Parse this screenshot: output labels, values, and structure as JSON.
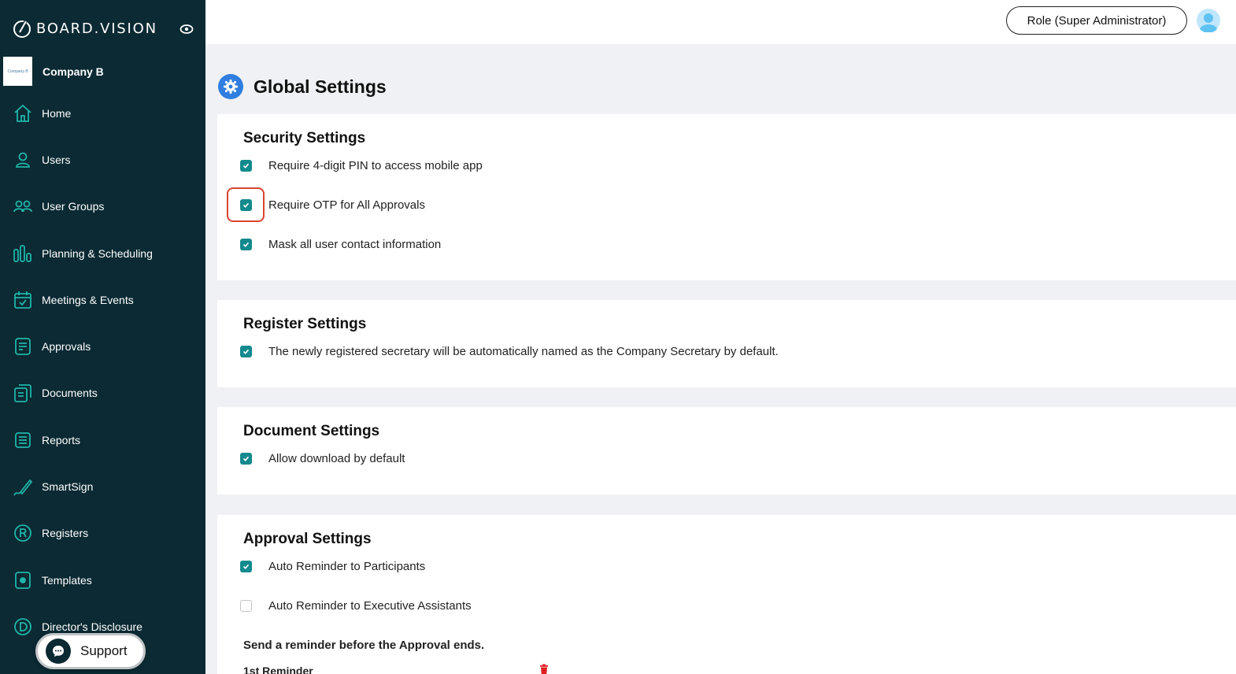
{
  "brand": {
    "name": "BOARD.VISION",
    "logo_icon": "board-vision-logo-icon"
  },
  "company": {
    "name": "Company B",
    "logo_text": "Company B"
  },
  "sidebar": {
    "items": [
      {
        "label": "Home",
        "icon": "home-icon"
      },
      {
        "label": "Users",
        "icon": "user-icon"
      },
      {
        "label": "User Groups",
        "icon": "user-group-icon"
      },
      {
        "label": "Planning & Scheduling",
        "icon": "bar-chart-icon"
      },
      {
        "label": "Meetings & Events",
        "icon": "calendar-check-icon"
      },
      {
        "label": "Approvals",
        "icon": "approval-doc-icon"
      },
      {
        "label": "Documents",
        "icon": "documents-icon"
      },
      {
        "label": "Reports",
        "icon": "report-list-icon"
      },
      {
        "label": "SmartSign",
        "icon": "pen-sign-icon"
      },
      {
        "label": "Registers",
        "icon": "registered-r-icon"
      },
      {
        "label": "Templates",
        "icon": "template-icon"
      },
      {
        "label": "Director's Disclosure",
        "icon": "disclosure-d-icon"
      }
    ]
  },
  "support": {
    "label": "Support"
  },
  "topbar": {
    "role_label": "Role (Super Administrator)"
  },
  "page": {
    "title": "Global Settings"
  },
  "security": {
    "title": "Security Settings",
    "options": [
      {
        "label": "Require 4-digit PIN to access mobile app",
        "checked": true
      },
      {
        "label": "Require OTP for All Approvals",
        "checked": true
      },
      {
        "label": "Mask all user contact information",
        "checked": true
      }
    ]
  },
  "register": {
    "title": "Register Settings",
    "options": [
      {
        "label": "The newly registered secretary will be automatically named as the Company Secretary by default.",
        "checked": true
      }
    ]
  },
  "document": {
    "title": "Document Settings",
    "options": [
      {
        "label": "Allow download by default",
        "checked": true
      }
    ]
  },
  "approval": {
    "title": "Approval Settings",
    "options": [
      {
        "label": "Auto Reminder to Participants",
        "checked": true
      },
      {
        "label": "Auto Reminder to Executive Assistants",
        "checked": false
      }
    ],
    "reminder_heading": "Send a reminder before the Approval ends.",
    "first_reminder_label": "1st Reminder"
  },
  "colors": {
    "sidebar_bg": "#0b2a33",
    "checkbox_checked": "#138a8d",
    "accent_blue": "#2f7ee0",
    "highlight_red": "#d9442f",
    "delete_red": "#e02020"
  }
}
